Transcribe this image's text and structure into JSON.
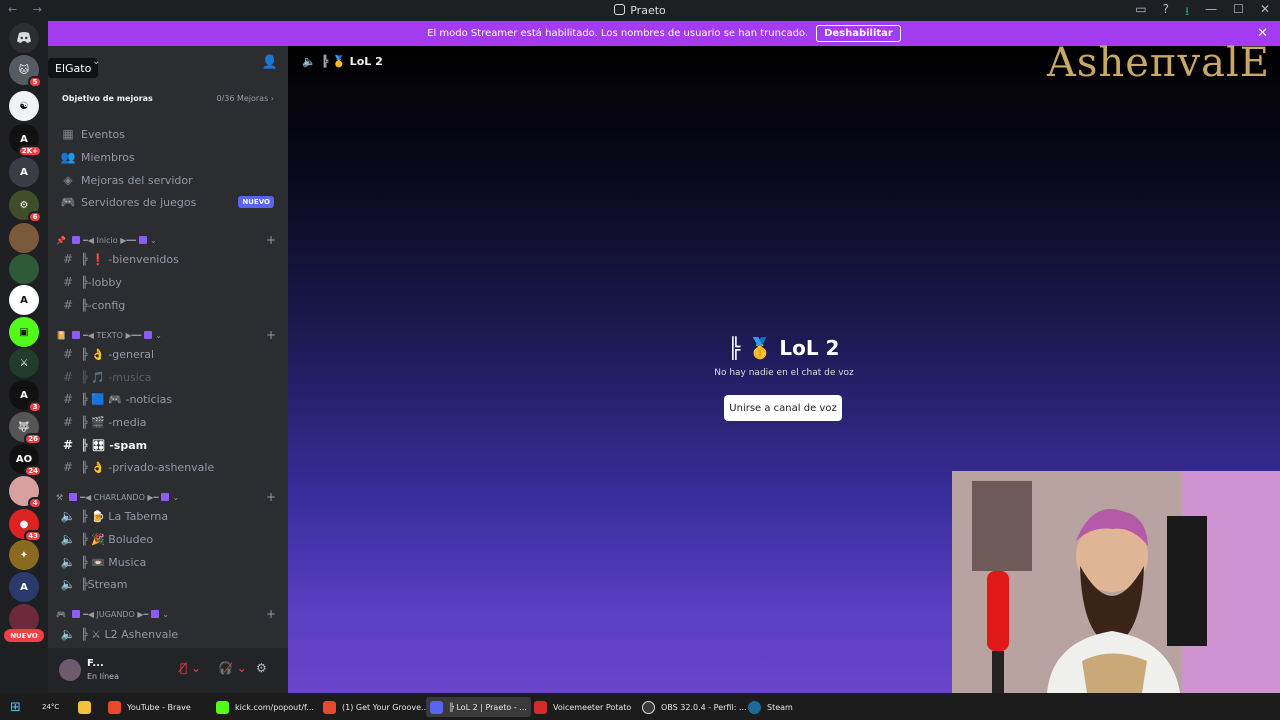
{
  "window": {
    "title": "Praeto",
    "nav": "← →"
  },
  "titlebar_icons": [
    "inbox-icon",
    "help-icon",
    "download-icon",
    "minimize-icon",
    "maximize-icon",
    "close-icon"
  ],
  "banner": {
    "text": "El modo Streamer está habilitado. Los nombres de usuario se han truncado.",
    "button": "Deshabilitar",
    "close": "✕"
  },
  "server": {
    "tooltip": "ElGato",
    "boost_label": "Objetivo de mejoras",
    "boost_value": "0/36 Mejoras"
  },
  "rail": {
    "badges": [
      "5",
      "2K+",
      "5",
      "6",
      "26",
      "24",
      "4",
      "43",
      "3"
    ],
    "new_label": "NUEVO"
  },
  "menu": [
    {
      "label": "Eventos",
      "icon": "calendar-icon"
    },
    {
      "label": "Miembros",
      "icon": "members-icon"
    },
    {
      "label": "Mejoras del servidor",
      "icon": "boost-icon"
    },
    {
      "label": "Servidores de juegos",
      "icon": "gamepad-icon",
      "tag": "NUEVO"
    }
  ],
  "categories": [
    {
      "label": "━◀ Inicio ▶━━",
      "channels": [
        {
          "label": "╠ ❗ -bienvenidos",
          "type": "text"
        },
        {
          "label": "╠-lobby",
          "type": "text"
        },
        {
          "label": "╠-config",
          "type": "text"
        }
      ]
    },
    {
      "label": "━◀ TEXTO ▶━━",
      "channels": [
        {
          "label": "╠ 👌 -general",
          "type": "text"
        },
        {
          "label": "╠ 🎵 -musica",
          "type": "text",
          "muted": true
        },
        {
          "label": "╠ 🟦 🎮 -noticias",
          "type": "text"
        },
        {
          "label": "╠ 🎬 -media",
          "type": "text"
        },
        {
          "label": "╠ 🎛 -spam",
          "type": "text",
          "active": true
        },
        {
          "label": "╠ 👌 -privado-ashenvale",
          "type": "text"
        }
      ]
    },
    {
      "label": "━◀ CHARLANDO ▶━",
      "channels": [
        {
          "label": "╠ 🍺 La Taberna",
          "type": "voice"
        },
        {
          "label": "╠ 🎉 Boludeo",
          "type": "voice"
        },
        {
          "label": "╠ 📼 Musica",
          "type": "voice"
        },
        {
          "label": "╠Stream",
          "type": "voice"
        }
      ]
    },
    {
      "label": "━◀ JUGANDO ▶━",
      "channels": [
        {
          "label": "╠ ⚔ L2 Ashenvale",
          "type": "voice"
        }
      ]
    }
  ],
  "user": {
    "name": "F...",
    "status": "En línea"
  },
  "main": {
    "channel": "╠ 🥇 LoL 2",
    "voice_title": "╠ 🥇 LoL 2",
    "voice_sub": "No hay nadie en el chat de voz",
    "join_button": "Unirse a canal de voz",
    "brand": "AsheпvalE"
  },
  "taskbar": {
    "weather": "24°C",
    "items": [
      {
        "label": "YouTube - Brave",
        "color": "#e8482c"
      },
      {
        "label": "kick.com/popout/f...",
        "color": "#53fc18"
      },
      {
        "label": "(1) Get Your Groove...",
        "color": "#e8482c"
      },
      {
        "label": "╠ LoL 2 | Praeto - ...",
        "color": "#5865f2",
        "active": true
      },
      {
        "label": "Voicemeeter Potato",
        "color": "#d62b2b"
      },
      {
        "label": "OBS 32.0.4 - Perfil: ...",
        "color": "#3a3a3a"
      },
      {
        "label": "Steam",
        "color": "#1b6a9c"
      }
    ]
  }
}
